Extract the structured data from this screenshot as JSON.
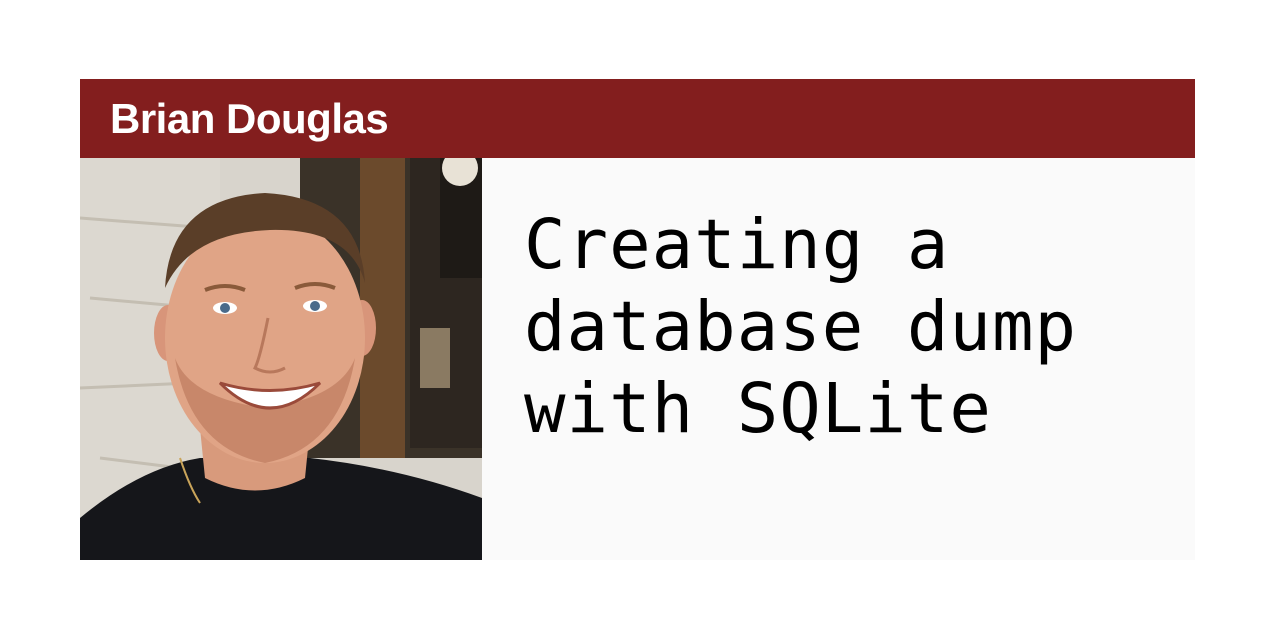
{
  "author": {
    "name": "Brian Douglas",
    "photo_alt": "Brian Douglas"
  },
  "post": {
    "title_lines": [
      "Creating a",
      "database dump",
      "with SQLite"
    ]
  },
  "colors": {
    "header_bar": "#831e1e",
    "card_background": "#fafafa",
    "page_background": "#ffffff",
    "title_text": "#000000",
    "author_text": "#ffffff"
  }
}
